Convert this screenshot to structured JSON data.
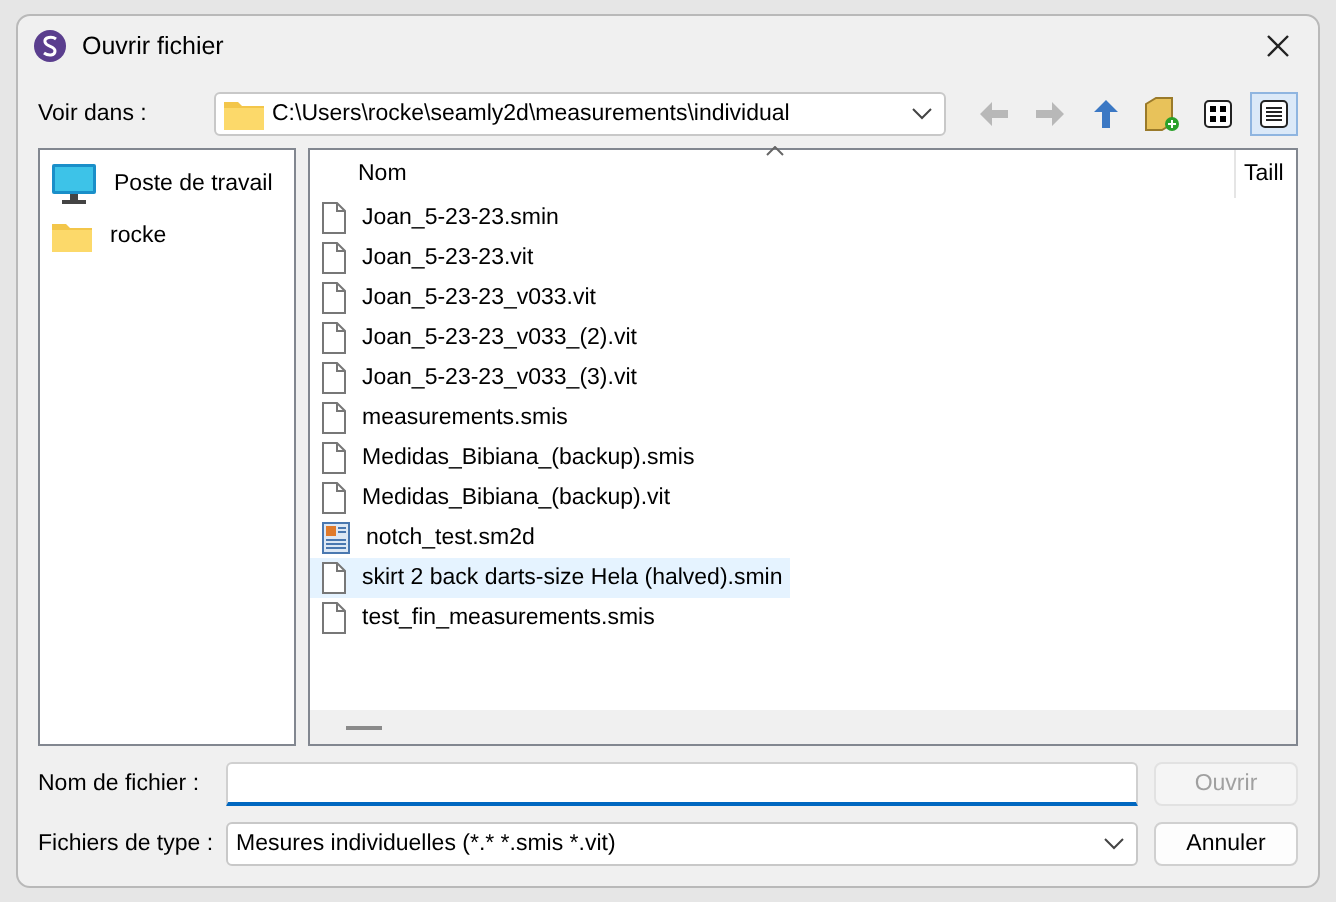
{
  "window": {
    "title": "Ouvrir fichier"
  },
  "look_in": {
    "label": "Voir dans :",
    "path": "C:\\Users\\rocke\\seamly2d\\measurements\\individual"
  },
  "toolbar": [
    {
      "kind": "back",
      "disabled": true
    },
    {
      "kind": "forward",
      "disabled": true
    },
    {
      "kind": "up",
      "disabled": false
    },
    {
      "kind": "new-folder",
      "disabled": false
    },
    {
      "kind": "list-view",
      "selected": false
    },
    {
      "kind": "detail-view",
      "selected": true
    }
  ],
  "sidebar": {
    "items": [
      {
        "kind": "computer",
        "label": "Poste de travail"
      },
      {
        "kind": "folder",
        "label": "rocke"
      }
    ]
  },
  "table": {
    "columns": [
      {
        "label": "Nom"
      },
      {
        "label": "Taill"
      }
    ],
    "rows": [
      {
        "kind": "file",
        "name": "Joan_5-23-23.smin",
        "selected": false
      },
      {
        "kind": "file",
        "name": "Joan_5-23-23.vit",
        "selected": false
      },
      {
        "kind": "file",
        "name": "Joan_5-23-23_v033.vit",
        "selected": false
      },
      {
        "kind": "file",
        "name": "Joan_5-23-23_v033_(2).vit",
        "selected": false
      },
      {
        "kind": "file",
        "name": "Joan_5-23-23_v033_(3).vit",
        "selected": false
      },
      {
        "kind": "file",
        "name": "measurements.smis",
        "selected": false
      },
      {
        "kind": "file",
        "name": "Medidas_Bibiana_(backup).smis",
        "selected": false
      },
      {
        "kind": "file",
        "name": "Medidas_Bibiana_(backup).vit",
        "selected": false
      },
      {
        "kind": "project",
        "name": "notch_test.sm2d",
        "selected": false
      },
      {
        "kind": "file",
        "name": "skirt 2 back darts-size Hela (halved).smin",
        "selected": true
      },
      {
        "kind": "file",
        "name": "test_fin_measurements.smis",
        "selected": false
      }
    ]
  },
  "file_name": {
    "label": "Nom de fichier :"
  },
  "file_type": {
    "label": "Fichiers de type :",
    "value": "Mesures individuelles (*.* *.smis *.vit)"
  },
  "buttons": [
    {
      "label": "Ouvrir",
      "disabled": true
    },
    {
      "label": "Annuler",
      "disabled": false
    }
  ]
}
